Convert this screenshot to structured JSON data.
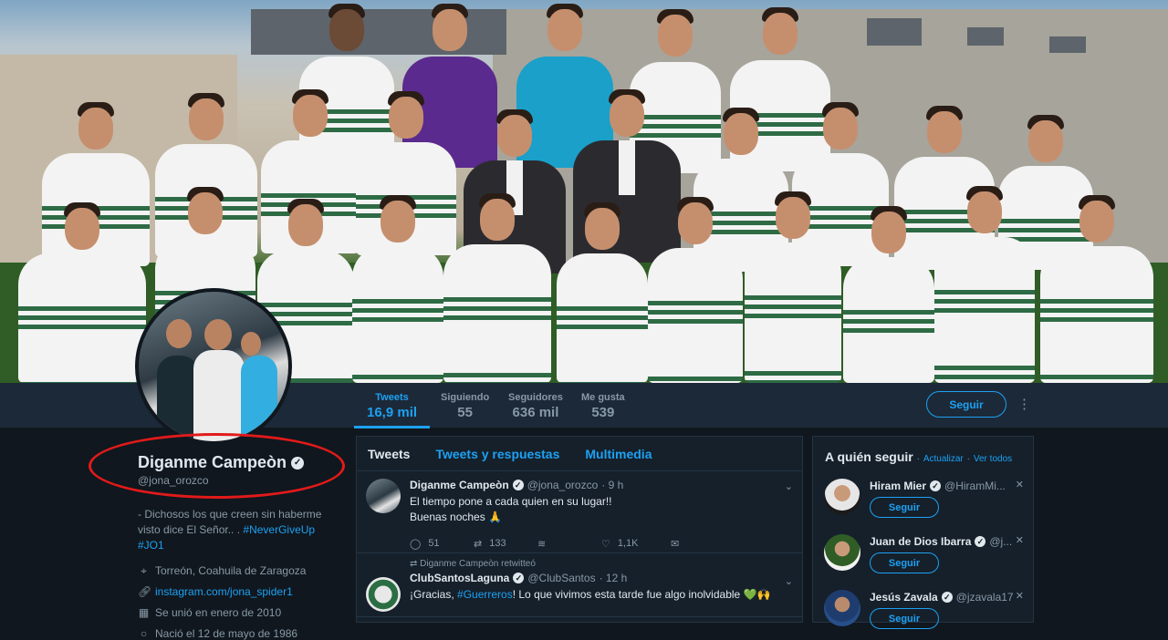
{
  "nav": {
    "stats": [
      {
        "label": "Tweets",
        "value": "16,9 mil",
        "active": true
      },
      {
        "label": "Siguiendo",
        "value": "55",
        "active": false
      },
      {
        "label": "Seguidores",
        "value": "636 mil",
        "active": false
      },
      {
        "label": "Me gusta",
        "value": "539",
        "active": false
      }
    ],
    "follow_label": "Seguir",
    "more_icon": "more-vertical-icon"
  },
  "profile": {
    "name": "Diganme Campeòn",
    "verified_icon": "verified-badge-icon",
    "handle": "@jona_orozco",
    "bio_text": "- Dichosos los que creen sin haberme visto dice El Señor.. . ",
    "bio_tags": [
      "#NeverGiveUp",
      "#JO1"
    ],
    "location": "Torreón, Coahuila de Zaragoza",
    "link": "instagram.com/jona_spider1",
    "joined": "Se unió en enero de 2010",
    "born": "Nació el 12 de mayo de 1986",
    "highlight_color": "#e21a1a"
  },
  "timeline": {
    "tabs": [
      "Tweets",
      "Tweets y respuestas",
      "Multimedia"
    ],
    "tweets": [
      {
        "name": "Diganme Campeòn",
        "handle": "@jona_orozco",
        "time": "· 9 h",
        "lines": [
          "El tiempo pone a cada quien en su lugar!!",
          "Buenas noches 🙏"
        ],
        "replies": "51",
        "retweets": "133",
        "likes": "1,1K"
      },
      {
        "retweet_note": "Diganme Campeòn retwitteó",
        "name": "ClubSantosLaguna",
        "handle": "@ClubSantos",
        "time": "· 12 h",
        "text_pre": "¡Gracias, ",
        "text_tag": "#Guerreros",
        "text_post": "! Lo que vivimos esta tarde fue algo inolvidable 💚🙌"
      }
    ]
  },
  "who_to_follow": {
    "title": "A quién seguir",
    "refresh": "Actualizar",
    "view_all": "Ver todos",
    "users": [
      {
        "name": "Hiram Mier",
        "handle": "@HiramMi...",
        "button": "Seguir"
      },
      {
        "name": "Juan de Dios Ibarra",
        "handle": "@j...",
        "button": "Seguir"
      },
      {
        "name": "Jesús Zavala",
        "handle": "@jzavala17",
        "button": "Seguir"
      }
    ]
  },
  "colors": {
    "accent": "#1da1f2",
    "background": "#10171e",
    "card": "#15202b"
  }
}
